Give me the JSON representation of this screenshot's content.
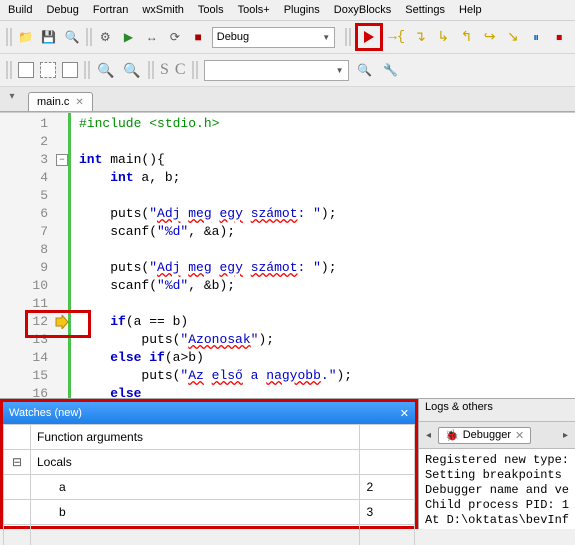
{
  "menu": [
    "Build",
    "Debug",
    "Fortran",
    "wxSmith",
    "Tools",
    "Tools+",
    "Plugins",
    "DoxyBlocks",
    "Settings",
    "Help"
  ],
  "toolbar1": {
    "build_config": "Debug",
    "icons": {
      "folder": "📁",
      "save": "💾",
      "mag": "🔍",
      "gear": "⚙",
      "play": "▶",
      "swap": "↔",
      "rebuild": "⟳",
      "stop": "■",
      "step_into": "↘",
      "step_over": "↷",
      "step_out": "↗",
      "run_to": "→",
      "bp": "●",
      "pause": "⏸",
      "stop2": "⏹"
    }
  },
  "toolbar2": {
    "combo": ""
  },
  "tab": {
    "name": "main.c"
  },
  "code": {
    "lines": [
      {
        "n": 1,
        "html": "<span class='pre'>#include &lt;stdio.h&gt;</span>"
      },
      {
        "n": 2,
        "html": ""
      },
      {
        "n": 3,
        "html": "<span class='kw'>int</span> main(){",
        "fold": true
      },
      {
        "n": 4,
        "html": "    <span class='kw'>int</span> a, b;"
      },
      {
        "n": 5,
        "html": ""
      },
      {
        "n": 6,
        "html": "    puts(<span class='str'>\"<span class='wavy'>Adj</span> <span class='wavy'>meg</span> <span class='wavy'>egy</span> <span class='wavy'>számot</span>: \"</span>);"
      },
      {
        "n": 7,
        "html": "    scanf(<span class='str'>\"%d\"</span>, &amp;a);"
      },
      {
        "n": 8,
        "html": ""
      },
      {
        "n": 9,
        "html": "    puts(<span class='str'>\"<span class='wavy'>Adj</span> <span class='wavy'>meg</span> <span class='wavy'>egy</span> <span class='wavy'>számot</span>: \"</span>);"
      },
      {
        "n": 10,
        "html": "    scanf(<span class='str'>\"%d\"</span>, &amp;b);"
      },
      {
        "n": 11,
        "html": ""
      },
      {
        "n": 12,
        "html": "    <span class='kw'>if</span>(a == b)",
        "bp": true
      },
      {
        "n": 13,
        "html": "        puts(<span class='str'>\"<span class='wavy'>Azonosak</span>\"</span>);"
      },
      {
        "n": 14,
        "html": "    <span class='kw'>else</span> <span class='kw'>if</span>(a&gt;b)"
      },
      {
        "n": 15,
        "html": "        puts(<span class='str'>\"<span class='wavy'>Az</span> <span class='wavy'>első</span> a <span class='wavy'>nagyobb</span>.\"</span>);"
      },
      {
        "n": 16,
        "html": "    <span class='kw'>else</span>"
      }
    ]
  },
  "watches": {
    "title": "Watches (new)",
    "rows": [
      {
        "tree": "",
        "label": "Function arguments",
        "val": ""
      },
      {
        "tree": "⊟",
        "label": "Locals",
        "val": ""
      },
      {
        "tree": "",
        "label": "a",
        "val": "2",
        "indent": true
      },
      {
        "tree": "",
        "label": "b",
        "val": "3",
        "indent": true
      },
      {
        "tree": "",
        "label": "",
        "val": ""
      }
    ]
  },
  "logs": {
    "panel_title": "Logs & others",
    "tab_label": "Debugger",
    "text": "Registered new type:\nSetting breakpoints\nDebugger name and ve\nChild process PID: 1\nAt D:\\oktatas\\bevInf"
  }
}
